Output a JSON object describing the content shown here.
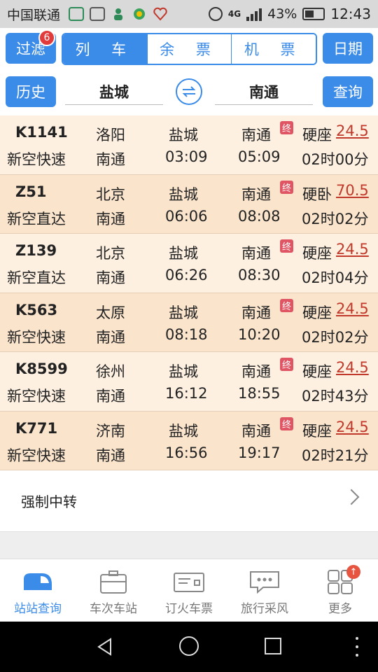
{
  "statusbar": {
    "carrier": "中国联通",
    "network": "4G",
    "battery": "43%",
    "time": "12:43",
    "icons": [
      "wechat-icon",
      "gallery-icon",
      "person-icon",
      "app-icon",
      "heart-icon"
    ]
  },
  "header": {
    "filter_label": "过滤",
    "filter_badge": "6",
    "tabs": [
      {
        "label": "列 车",
        "active": true
      },
      {
        "label": "余 票",
        "active": false
      },
      {
        "label": "机 票",
        "active": false
      }
    ],
    "date_label": "日期",
    "history_label": "历史",
    "from_station": "盐城",
    "to_station": "南通",
    "swap_icon": "swap-icon",
    "query_label": "查询"
  },
  "trains": [
    {
      "number": "K1141",
      "type": "新空快速",
      "origin": "洛阳",
      "destination": "南通",
      "from_station": "盐城",
      "departure": "03:09",
      "to_station": "南通",
      "arrival": "05:09",
      "terminal_mark": "终",
      "seat": "硬座",
      "price": "24.5",
      "duration": "02时00分"
    },
    {
      "number": "Z51",
      "type": "新空直达",
      "origin": "北京",
      "destination": "南通",
      "from_station": "盐城",
      "departure": "06:06",
      "to_station": "南通",
      "arrival": "08:08",
      "terminal_mark": "终",
      "seat": "硬卧",
      "price": "70.5",
      "duration": "02时02分"
    },
    {
      "number": "Z139",
      "type": "新空直达",
      "origin": "北京",
      "destination": "南通",
      "from_station": "盐城",
      "departure": "06:26",
      "to_station": "南通",
      "arrival": "08:30",
      "terminal_mark": "终",
      "seat": "硬座",
      "price": "24.5",
      "duration": "02时04分"
    },
    {
      "number": "K563",
      "type": "新空快速",
      "origin": "太原",
      "destination": "南通",
      "from_station": "盐城",
      "departure": "08:18",
      "to_station": "南通",
      "arrival": "10:20",
      "terminal_mark": "终",
      "seat": "硬座",
      "price": "24.5",
      "duration": "02时02分"
    },
    {
      "number": "K8599",
      "type": "新空快速",
      "origin": "徐州",
      "destination": "南通",
      "from_station": "盐城",
      "departure": "16:12",
      "to_station": "南通",
      "arrival": "18:55",
      "terminal_mark": "终",
      "seat": "硬座",
      "price": "24.5",
      "duration": "02时43分"
    },
    {
      "number": "K771",
      "type": "新空快速",
      "origin": "济南",
      "destination": "南通",
      "from_station": "盐城",
      "departure": "16:56",
      "to_station": "南通",
      "arrival": "19:17",
      "terminal_mark": "终",
      "seat": "硬座",
      "price": "24.5",
      "duration": "02时21分"
    }
  ],
  "transfer": {
    "label": "强制中转"
  },
  "bottomnav": {
    "items": [
      {
        "label": "站站查询",
        "icon": "train-icon",
        "active": true
      },
      {
        "label": "车次车站",
        "icon": "briefcase-icon",
        "active": false
      },
      {
        "label": "订火车票",
        "icon": "ticket-icon",
        "active": false
      },
      {
        "label": "旅行采风",
        "icon": "chat-icon",
        "active": false
      },
      {
        "label": "更多",
        "icon": "grid-icon",
        "active": false
      }
    ]
  },
  "colors": {
    "accent": "#3b8be8",
    "price": "#c0392b",
    "row_odd": "#fdf0e0",
    "row_even": "#fbe4cc"
  }
}
